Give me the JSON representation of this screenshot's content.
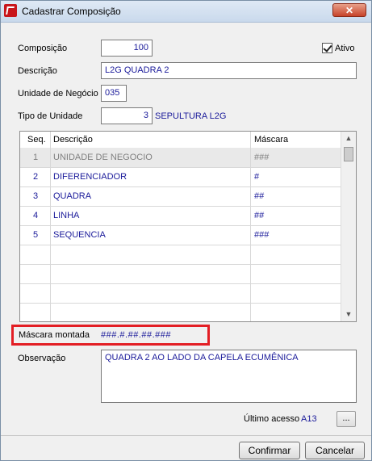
{
  "window": {
    "title": "Cadastrar Composição",
    "close_icon": "✕"
  },
  "form": {
    "composicao_label": "Composição",
    "composicao_value": "100",
    "ativo_label": "Ativo",
    "ativo_checked": true,
    "descricao_label": "Descrição",
    "descricao_value": "L2G QUADRA 2",
    "unidade_label": "Unidade de Negócio",
    "unidade_value": "035",
    "tipo_label": "Tipo de Unidade",
    "tipo_value": "3",
    "tipo_desc": "SEPULTURA L2G"
  },
  "grid": {
    "headers": {
      "seq": "Seq.",
      "descricao": "Descrição",
      "mascara": "Máscara"
    },
    "rows": [
      {
        "seq": "1",
        "descricao": "UNIDADE DE NEGOCIO",
        "mascara": "###"
      },
      {
        "seq": "2",
        "descricao": "DIFERENCIADOR",
        "mascara": "#"
      },
      {
        "seq": "3",
        "descricao": "QUADRA",
        "mascara": "##"
      },
      {
        "seq": "4",
        "descricao": "LINHA",
        "mascara": "##"
      },
      {
        "seq": "5",
        "descricao": "SEQUENCIA",
        "mascara": "###"
      }
    ],
    "scroll_up": "▲",
    "scroll_down": "▼"
  },
  "mascara_montada": {
    "label": "Máscara montada",
    "value": "###.#.##.##.###"
  },
  "observacao": {
    "label": "Observação",
    "value": "QUADRA 2 AO LADO DA CAPELA ECUMÊNICA"
  },
  "ultimo_acesso": {
    "label": "Último acesso",
    "value": "A13",
    "button": "..."
  },
  "buttons": {
    "confirmar": "Confirmar",
    "cancelar": "Cancelar"
  }
}
